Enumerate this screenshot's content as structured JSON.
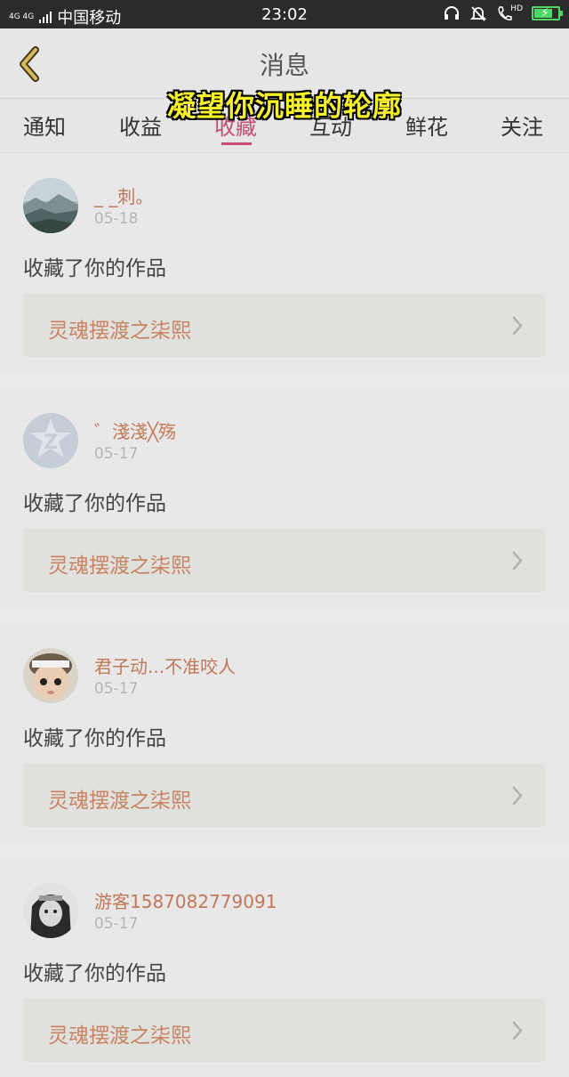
{
  "status_bar": {
    "network": "4G 4G",
    "carrier": "中国移动",
    "time": "23:02",
    "icons": [
      "headset-icon",
      "bell-muted-icon",
      "hd-call-icon",
      "battery-charging-icon"
    ],
    "battery_level": 0.7,
    "hd_label": "HD"
  },
  "header": {
    "title": "消息",
    "back_icon": "chevron-left-icon"
  },
  "overlay": {
    "caption": "凝望你沉睡的轮廓"
  },
  "tabs": [
    {
      "label": "通知",
      "active": false
    },
    {
      "label": "收益",
      "active": false
    },
    {
      "label": "收藏",
      "active": true
    },
    {
      "label": "互动",
      "active": false
    },
    {
      "label": "鲜花",
      "active": false
    },
    {
      "label": "关注",
      "active": false
    }
  ],
  "messages": [
    {
      "name": "_ _刺。",
      "date": "05-18",
      "action": "收藏了你的作品",
      "work_title": "灵魂摆渡之柒熙",
      "avatar": "landscape-avatar"
    },
    {
      "name": "゛淺淺╳殇",
      "date": "05-17",
      "action": "收藏了你的作品",
      "work_title": "灵魂摆渡之柒熙",
      "avatar": "default-avatar"
    },
    {
      "name": "君子动...不准咬人",
      "date": "05-17",
      "action": "收藏了你的作品",
      "work_title": "灵魂摆渡之柒熙",
      "avatar": "doll-avatar"
    },
    {
      "name": "游客1587082779091",
      "date": "05-17",
      "action": "收藏了你的作品",
      "work_title": "灵魂摆渡之柒熙",
      "avatar": "character-avatar"
    }
  ],
  "colors": {
    "accent": "#c84c73",
    "name": "#c07858",
    "work_title": "#c98262",
    "caption": "#f5f02a"
  }
}
